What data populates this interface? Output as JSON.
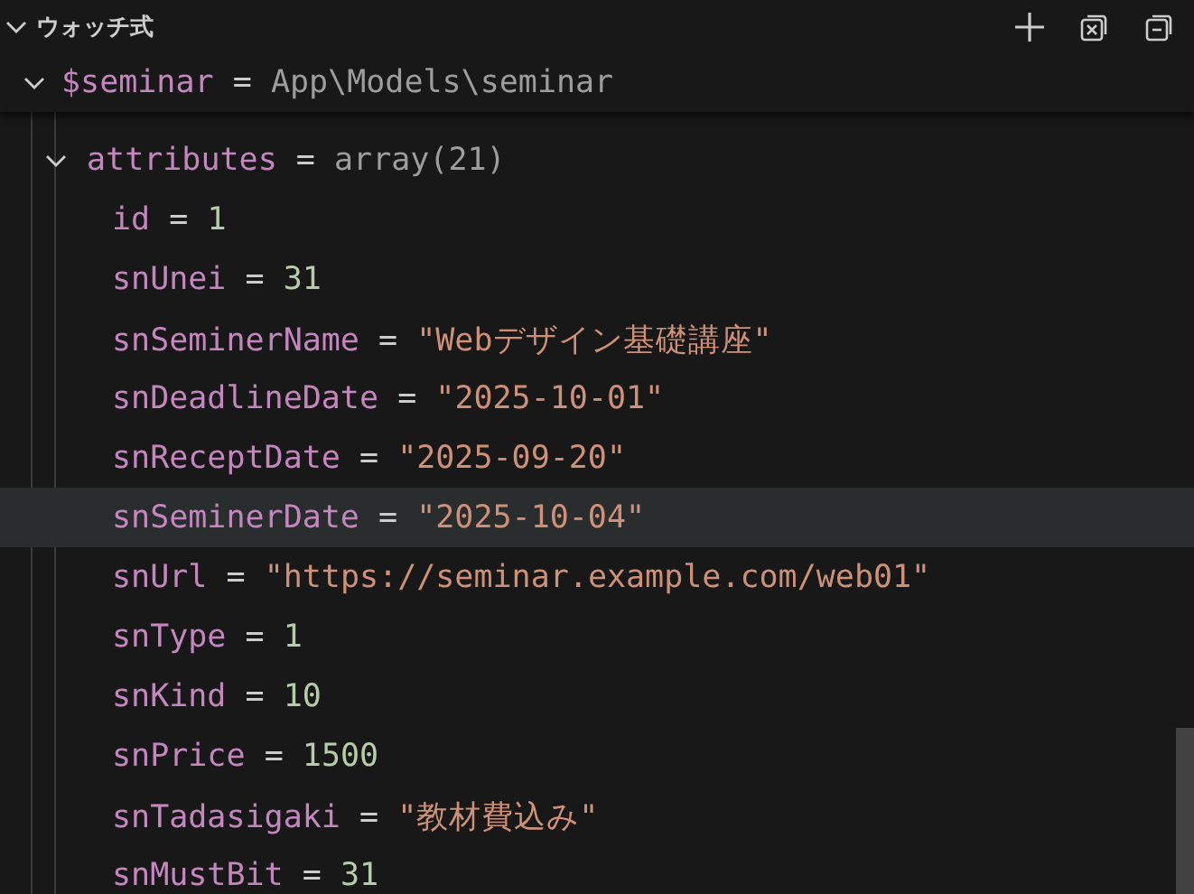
{
  "panel": {
    "title": "ウォッチ式",
    "expanded": true
  },
  "separator": "=",
  "watch": {
    "name": "$seminar",
    "value": "App\\Models\\seminar",
    "expanded": true,
    "children": [
      {
        "name": "attributes",
        "value": "array(21)",
        "expanded": true,
        "children": [
          {
            "name": "id",
            "value": "1",
            "kind": "number",
            "selected": false
          },
          {
            "name": "snUnei",
            "value": "31",
            "kind": "number",
            "selected": false
          },
          {
            "name": "snSeminerName",
            "value": "\"Webデザイン基礎講座\"",
            "kind": "string",
            "selected": false
          },
          {
            "name": "snDeadlineDate",
            "value": "\"2025-10-01\"",
            "kind": "string",
            "selected": false
          },
          {
            "name": "snReceptDate",
            "value": "\"2025-09-20\"",
            "kind": "string",
            "selected": false
          },
          {
            "name": "snSeminerDate",
            "value": "\"2025-10-04\"",
            "kind": "string",
            "selected": true
          },
          {
            "name": "snUrl",
            "value": "\"https://seminar.example.com/web01\"",
            "kind": "string",
            "selected": false
          },
          {
            "name": "snType",
            "value": "1",
            "kind": "number",
            "selected": false
          },
          {
            "name": "snKind",
            "value": "10",
            "kind": "number",
            "selected": false
          },
          {
            "name": "snPrice",
            "value": "1500",
            "kind": "number",
            "selected": false
          },
          {
            "name": "snTadasigaki",
            "value": "\"教材費込み\"",
            "kind": "string",
            "selected": false
          },
          {
            "name": "snMustBit",
            "value": "31",
            "kind": "number",
            "selected": false
          }
        ]
      }
    ]
  }
}
